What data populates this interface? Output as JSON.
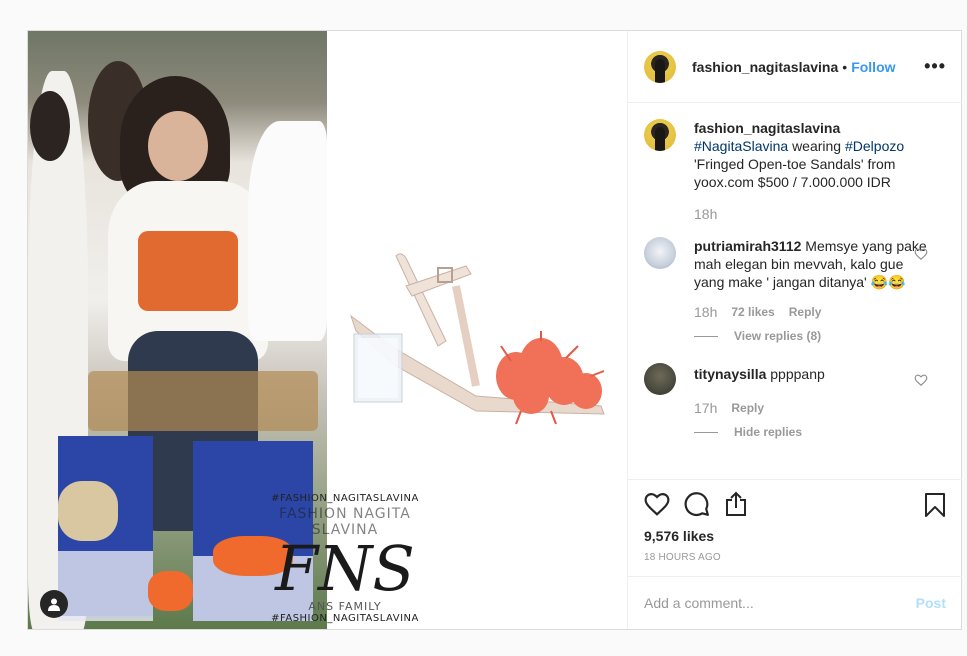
{
  "header": {
    "username": "fashion_nagitaslavina",
    "separator": "•",
    "follow_label": "Follow",
    "more_icon": "more-horizontal-icon"
  },
  "media": {
    "watermark_tag_top": "#FASHION_NAGITASLAVINA",
    "watermark_name": "FASHION NAGITA SLAVINA",
    "watermark_logo": "FNS",
    "watermark_family": "ANS FAMILY",
    "watermark_tag_bottom": "#FASHION_NAGITASLAVINA",
    "user_tag_icon": "person-icon"
  },
  "caption": {
    "username": "fashion_nagitaslavina",
    "hashtag1": "#NagitaSlavina",
    "text1": "wearing",
    "hashtag2": "#Delpozo",
    "text2": "'Fringed Open-toe Sandals' from yoox.com $500 / 7.000.000 IDR",
    "time": "18h"
  },
  "comments": [
    {
      "username": "putriamirah3112",
      "text": "Memsye yang pake mah elegan bin mevvah, kalo gue yang make ' jangan ditanya' 😂😂",
      "time": "18h",
      "likes": "72 likes",
      "reply_label": "Reply",
      "replies_label": "View replies (8)",
      "avatar_color": "#c8d0dc"
    },
    {
      "username": "titynaysilla",
      "text": "ppppanp",
      "time": "17h",
      "reply_label": "Reply",
      "replies_label": "Hide replies",
      "avatar_color": "#4a4a3e"
    }
  ],
  "actions": {
    "like_icon": "heart-icon",
    "comment_icon": "comment-icon",
    "share_icon": "share-icon",
    "bookmark_icon": "bookmark-icon",
    "likes_count": "9,576 likes",
    "timestamp": "18 HOURS AGO"
  },
  "add_comment": {
    "placeholder": "Add a comment...",
    "post_label": "Post"
  },
  "colors": {
    "accent": "#3897f0",
    "hashtag": "#003569",
    "muted": "#999999",
    "post_disabled": "#b2dffc"
  }
}
